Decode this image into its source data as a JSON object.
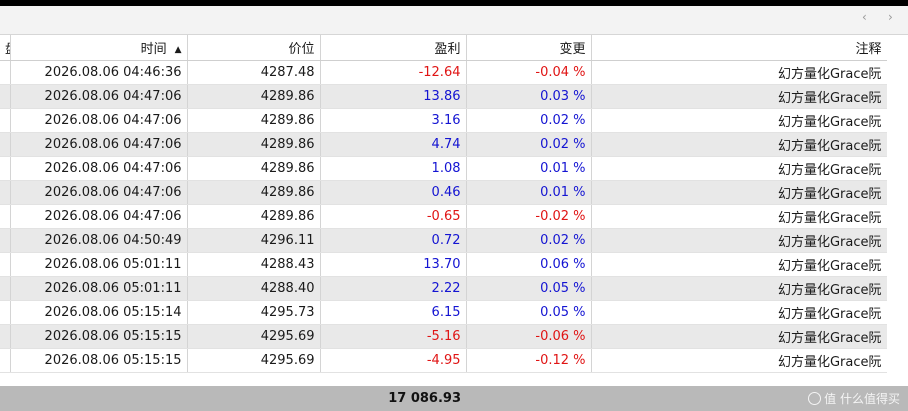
{
  "toolbar": {
    "nav_left_glyph": "‹",
    "nav_right_glyph": "›"
  },
  "columns": {
    "clipped": "盘",
    "time": "时间",
    "sort_glyph": "▲",
    "price": "价位",
    "profit": "盈利",
    "change": "变更",
    "comment": "注释"
  },
  "rows": [
    {
      "time": "2026.08.06 04:46:36",
      "price": "4287.48",
      "profit": "-12.64",
      "change": "-0.04 %",
      "comment": "幻方量化Grace阮"
    },
    {
      "time": "2026.08.06 04:47:06",
      "price": "4289.86",
      "profit": "13.86",
      "change": "0.03 %",
      "comment": "幻方量化Grace阮"
    },
    {
      "time": "2026.08.06 04:47:06",
      "price": "4289.86",
      "profit": "3.16",
      "change": "0.02 %",
      "comment": "幻方量化Grace阮"
    },
    {
      "time": "2026.08.06 04:47:06",
      "price": "4289.86",
      "profit": "4.74",
      "change": "0.02 %",
      "comment": "幻方量化Grace阮"
    },
    {
      "time": "2026.08.06 04:47:06",
      "price": "4289.86",
      "profit": "1.08",
      "change": "0.01 %",
      "comment": "幻方量化Grace阮"
    },
    {
      "time": "2026.08.06 04:47:06",
      "price": "4289.86",
      "profit": "0.46",
      "change": "0.01 %",
      "comment": "幻方量化Grace阮"
    },
    {
      "time": "2026.08.06 04:47:06",
      "price": "4289.86",
      "profit": "-0.65",
      "change": "-0.02 %",
      "comment": "幻方量化Grace阮"
    },
    {
      "time": "2026.08.06 04:50:49",
      "price": "4296.11",
      "profit": "0.72",
      "change": "0.02 %",
      "comment": "幻方量化Grace阮"
    },
    {
      "time": "2026.08.06 05:01:11",
      "price": "4288.43",
      "profit": "13.70",
      "change": "0.06 %",
      "comment": "幻方量化Grace阮"
    },
    {
      "time": "2026.08.06 05:01:11",
      "price": "4288.40",
      "profit": "2.22",
      "change": "0.05 %",
      "comment": "幻方量化Grace阮"
    },
    {
      "time": "2026.08.06 05:15:14",
      "price": "4295.73",
      "profit": "6.15",
      "change": "0.05 %",
      "comment": "幻方量化Grace阮"
    },
    {
      "time": "2026.08.06 05:15:15",
      "price": "4295.69",
      "profit": "-5.16",
      "change": "-0.06 %",
      "comment": "幻方量化Grace阮"
    },
    {
      "time": "2026.08.06 05:15:15",
      "price": "4295.69",
      "profit": "-4.95",
      "change": "-0.12 %",
      "comment": "幻方量化Grace阮"
    }
  ],
  "footer": {
    "total_profit": "17 086.93",
    "watermark": "值 什么值得买"
  },
  "colors": {
    "negative": "#e01414",
    "positive": "#1414d2",
    "alt_row": "#e9e9e9",
    "footer_bg": "#b9b9b9"
  }
}
